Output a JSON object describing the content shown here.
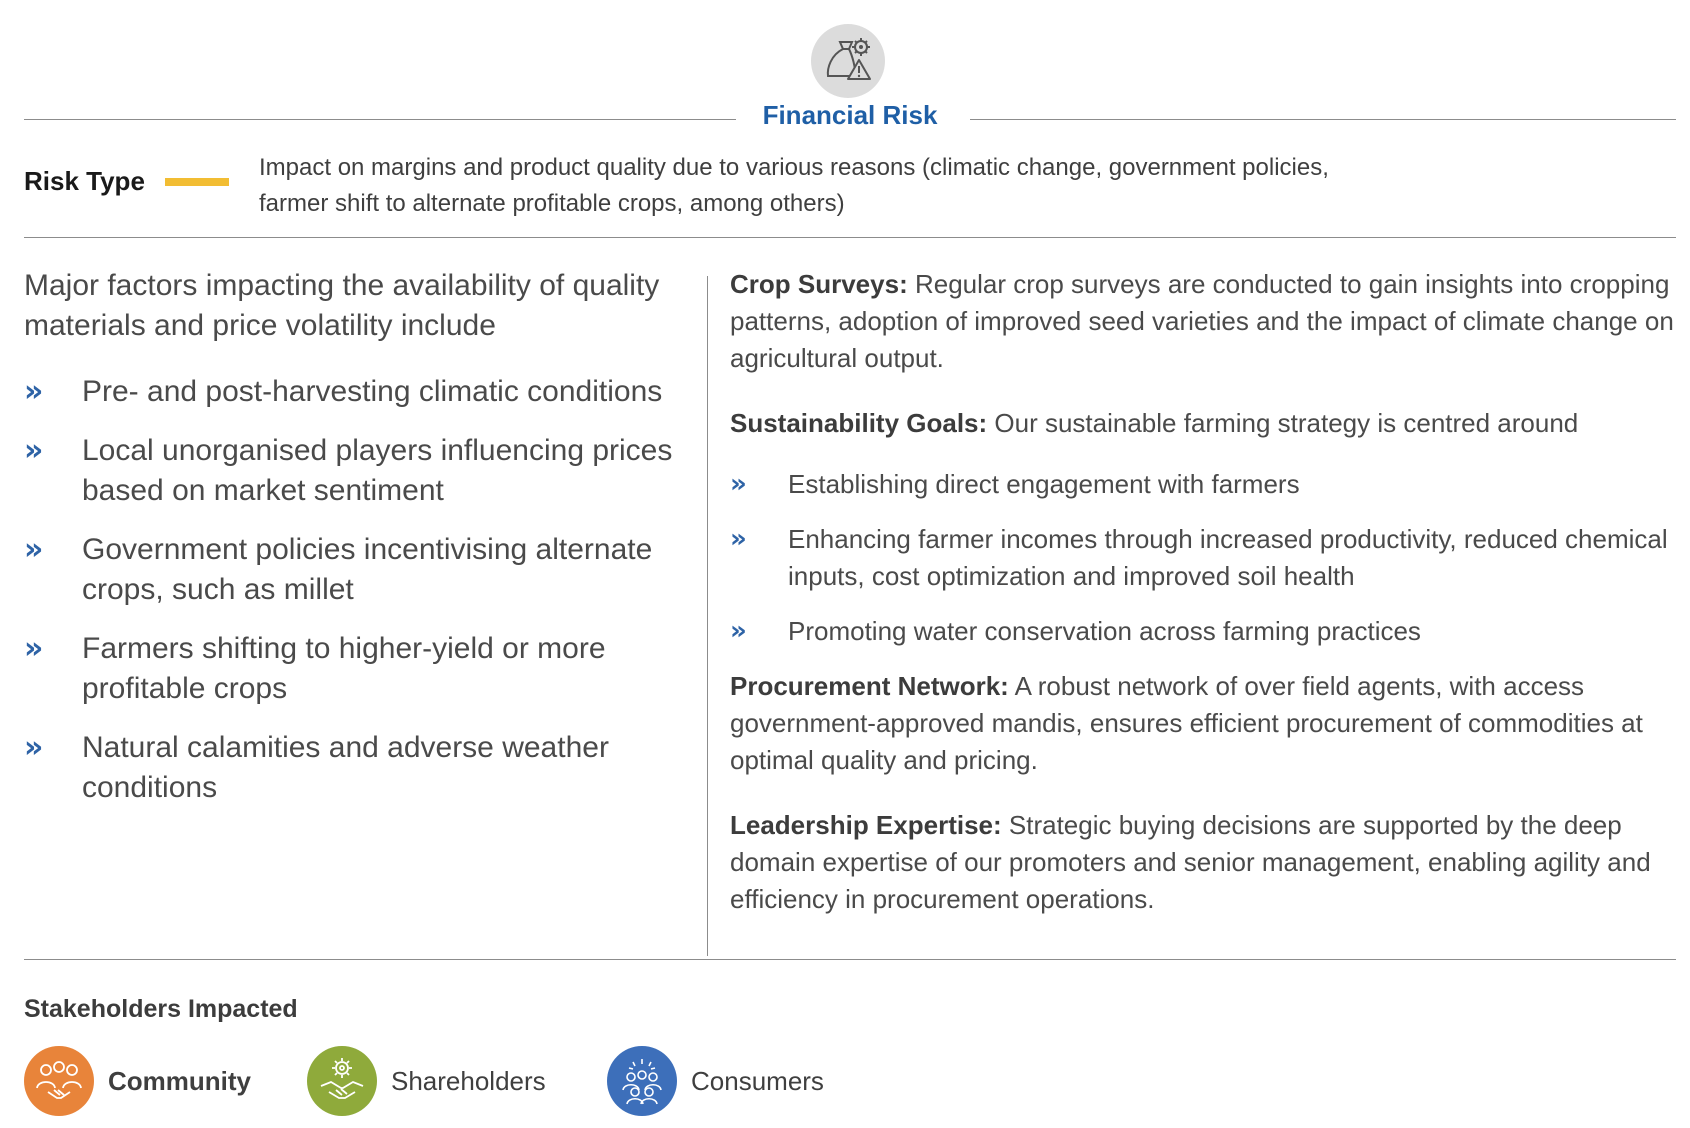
{
  "header": {
    "icon": "money-bag-gear-warning-icon",
    "title": "Financial Risk"
  },
  "risk_type": {
    "label": "Risk Type",
    "accent_color": "#f2bd33",
    "description_line1": "Impact on margins and product quality due to various reasons (climatic change, government policies,",
    "description_line2": "farmer shift to alternate profitable crops, among others)"
  },
  "left": {
    "intro": "Major factors impacting the availability of quality materials and price volatility include",
    "bullet_marker": "»",
    "items": [
      "Pre- and post-harvesting climatic conditions",
      "Local unorganised players influencing prices based on market sentiment",
      "Government policies incentivising alternate crops, such as millet",
      "Farmers shifting to higher-yield or more profitable crops",
      "Natural calamities and adverse weather conditions"
    ]
  },
  "right": {
    "crop_surveys": {
      "heading": "Crop Surveys:",
      "text": "Regular crop surveys are conducted to gain insights into cropping patterns, adoption of improved seed varieties and the impact of climate change on agricultural output."
    },
    "sustainability": {
      "heading": "Sustainability Goals:",
      "text": "Our sustainable farming strategy is centred around",
      "items": [
        "Establishing direct engagement with farmers",
        "Enhancing farmer incomes through increased productivity, reduced chemical inputs, cost optimization and improved soil health",
        "Promoting water conservation across farming practices"
      ]
    },
    "procurement": {
      "heading": "Procurement Network:",
      "text": "A robust network of over field agents, with access government-approved mandis, ensures efficient procurement of commodities at optimal quality and pricing."
    },
    "leadership": {
      "heading": "Leadership Expertise:",
      "text": "Strategic buying decisions are supported by the deep domain expertise of our promoters and senior management, enabling agility and efficiency in procurement operations."
    }
  },
  "stakeholders": {
    "title": "Stakeholders Impacted",
    "items": [
      {
        "label": "Community",
        "color": "#e8843a",
        "icon": "people-handshake-icon"
      },
      {
        "label": "Shareholders",
        "color": "#8faa3b",
        "icon": "gear-handshake-icon"
      },
      {
        "label": "Consumers",
        "color": "#3d6fba",
        "icon": "people-group-icon"
      }
    ]
  },
  "colors": {
    "title_blue": "#1f5fa6",
    "bullet_blue": "#2e63a6",
    "rule_gray": "#8c8c8c"
  }
}
